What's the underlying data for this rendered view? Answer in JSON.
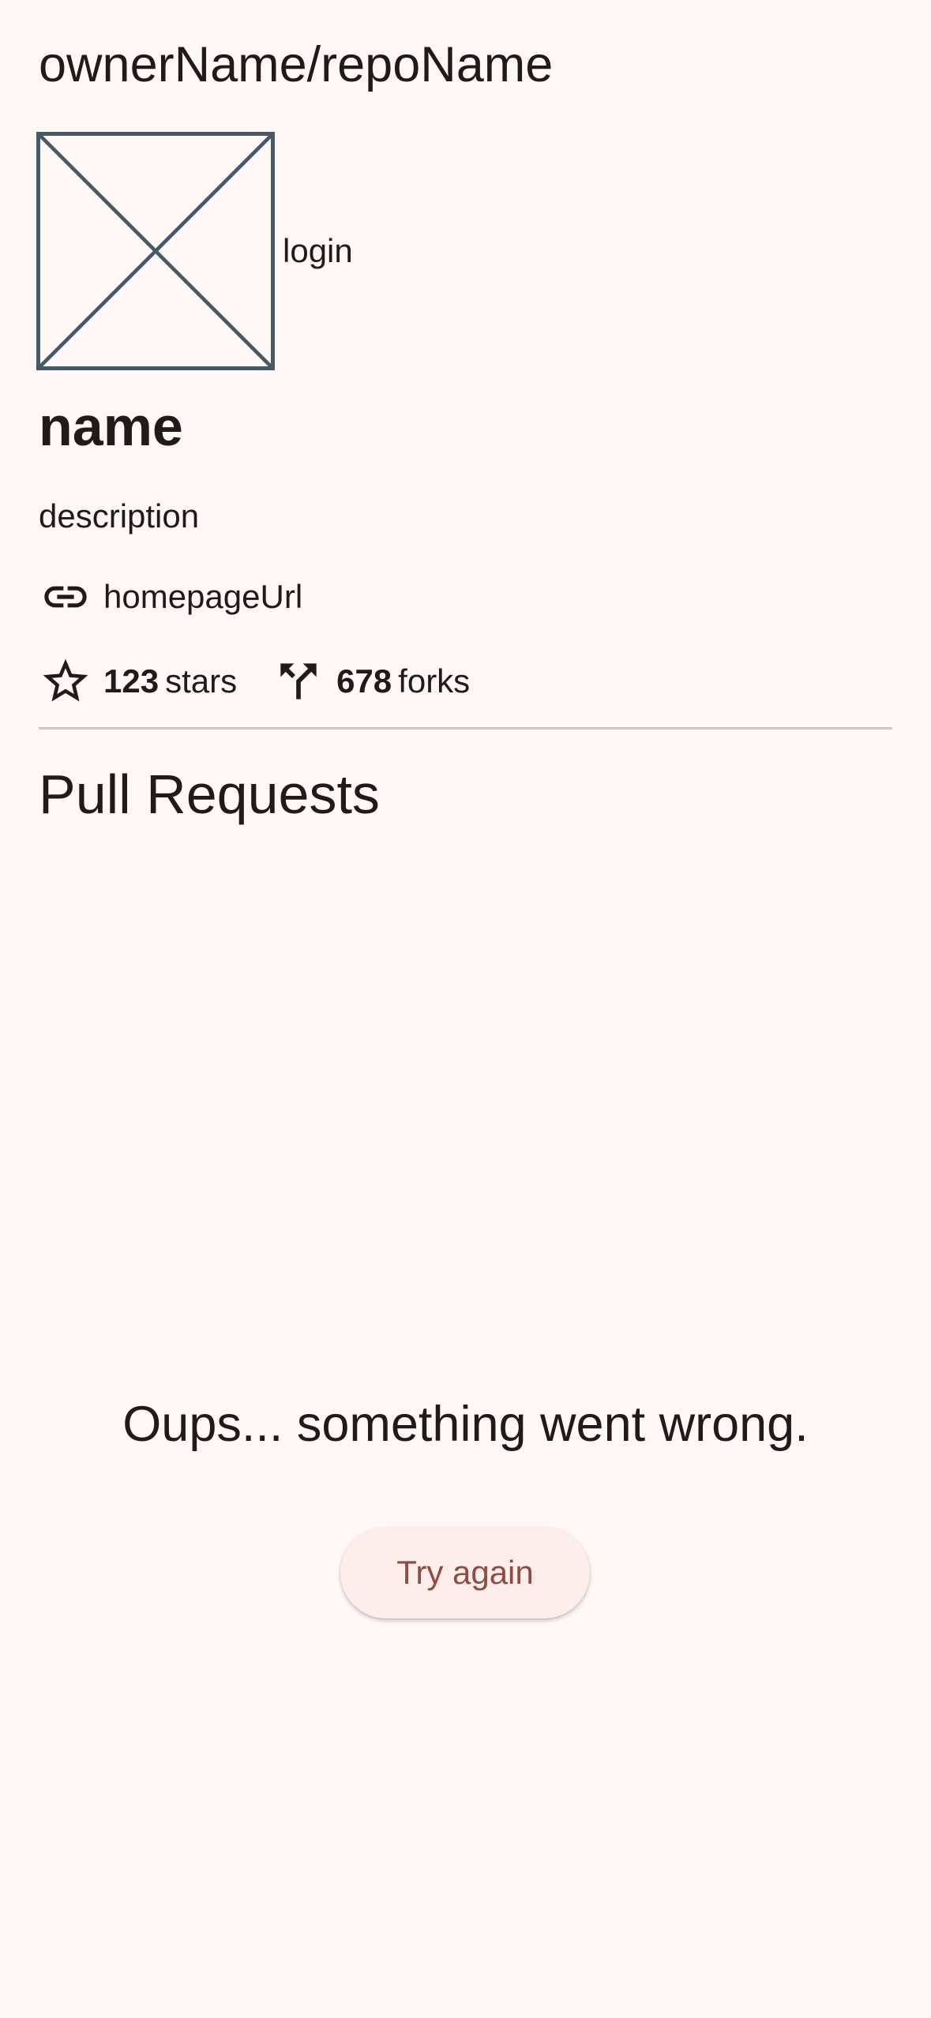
{
  "header": {
    "title": "ownerName/repoName"
  },
  "owner": {
    "avatar_icon": "broken-image-placeholder",
    "login": "login"
  },
  "repo": {
    "name": "name",
    "description": "description",
    "homepage_icon": "link-icon",
    "homepage_url": "homepageUrl",
    "stars_icon": "star-outline-icon",
    "stars_count": "123",
    "stars_unit": "stars",
    "forks_icon": "fork-icon",
    "forks_count": "678",
    "forks_unit": "forks"
  },
  "pull_requests": {
    "section_title": "Pull Requests",
    "error_message": "Oups... something went wrong.",
    "retry_label": "Try again"
  },
  "colors": {
    "background": "#fff8f6",
    "text": "#231918",
    "avatar_placeholder": "#455a64",
    "divider": "#d8c2bf",
    "button_background": "#fdeeeb",
    "button_text": "#8f4c42"
  }
}
